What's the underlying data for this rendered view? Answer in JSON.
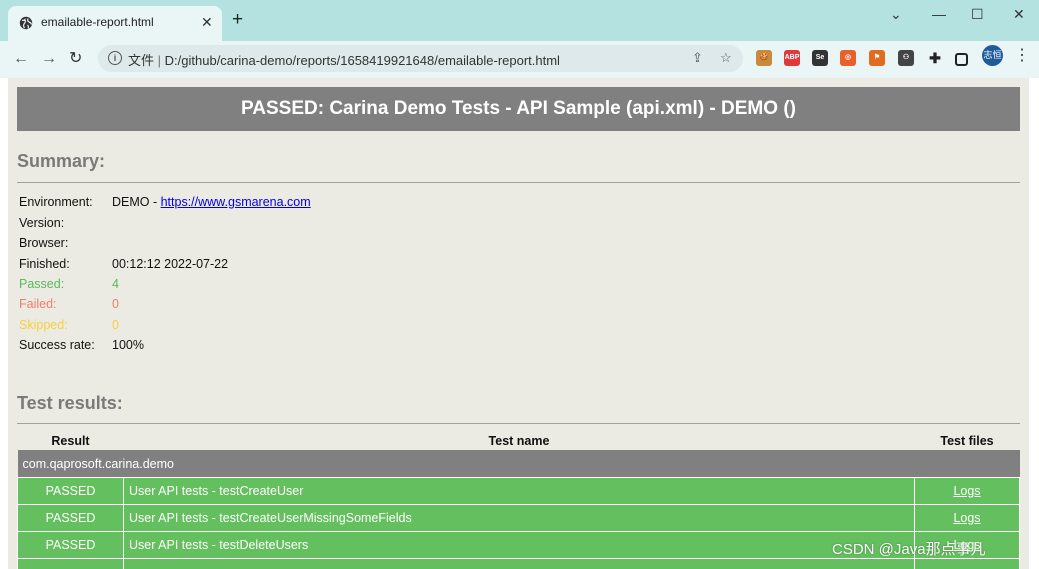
{
  "browser": {
    "tab_title": "emailable-report.html",
    "tab_close": "✕",
    "new_tab": "+",
    "minimize": "—",
    "maximize": "☐",
    "close": "✕",
    "back": "←",
    "forward": "→",
    "reload": "↻",
    "address_prefix": "文件",
    "address_separator": "|",
    "address_url": "D:/github/carina-demo/reports/1658419921648/emailable-report.html",
    "avatar_text": "志恒"
  },
  "extensions": [
    {
      "name": "cookie-extension-icon",
      "label": "🍪",
      "color": "#c98a3b"
    },
    {
      "name": "adblock-icon",
      "label": "ABP",
      "color": "#e0393a"
    },
    {
      "name": "selenium-icon",
      "label": "Se",
      "color": "#333333"
    },
    {
      "name": "target-extension-icon",
      "label": "◎",
      "color": "#e8602c"
    },
    {
      "name": "fire-extension-icon",
      "label": "⚑",
      "color": "#e36b1f"
    },
    {
      "name": "people-extension-icon",
      "label": "⚇",
      "color": "#444444"
    }
  ],
  "report": {
    "banner": "PASSED: Carina Demo Tests - API Sample (api.xml) - DEMO ()",
    "summary_heading": "Summary:",
    "summary": {
      "environment_label": "Environment:",
      "environment_value": "DEMO - ",
      "environment_link": "https://www.gsmarena.com",
      "version_label": "Version:",
      "browser_label": "Browser:",
      "finished_label": "Finished:",
      "finished_value": "00:12:12 2022-07-22",
      "passed_label": "Passed:",
      "passed_value": "4",
      "failed_label": "Failed:",
      "failed_value": "0",
      "skipped_label": "Skipped:",
      "skipped_value": "0",
      "success_label": "Success rate:",
      "success_value": "100%"
    },
    "results_heading": "Test results:",
    "columns": [
      "Result",
      "Test name",
      "Test files"
    ],
    "package": "com.qaprosoft.carina.demo",
    "rows": [
      {
        "result": "PASSED",
        "name": "User API tests - testCreateUser",
        "files": "Logs"
      },
      {
        "result": "PASSED",
        "name": "User API tests - testCreateUserMissingSomeFields",
        "files": "Logs"
      },
      {
        "result": "PASSED",
        "name": "User API tests - testDeleteUsers",
        "files": "Logs"
      }
    ]
  },
  "watermark": "CSDN @Java那点事儿"
}
